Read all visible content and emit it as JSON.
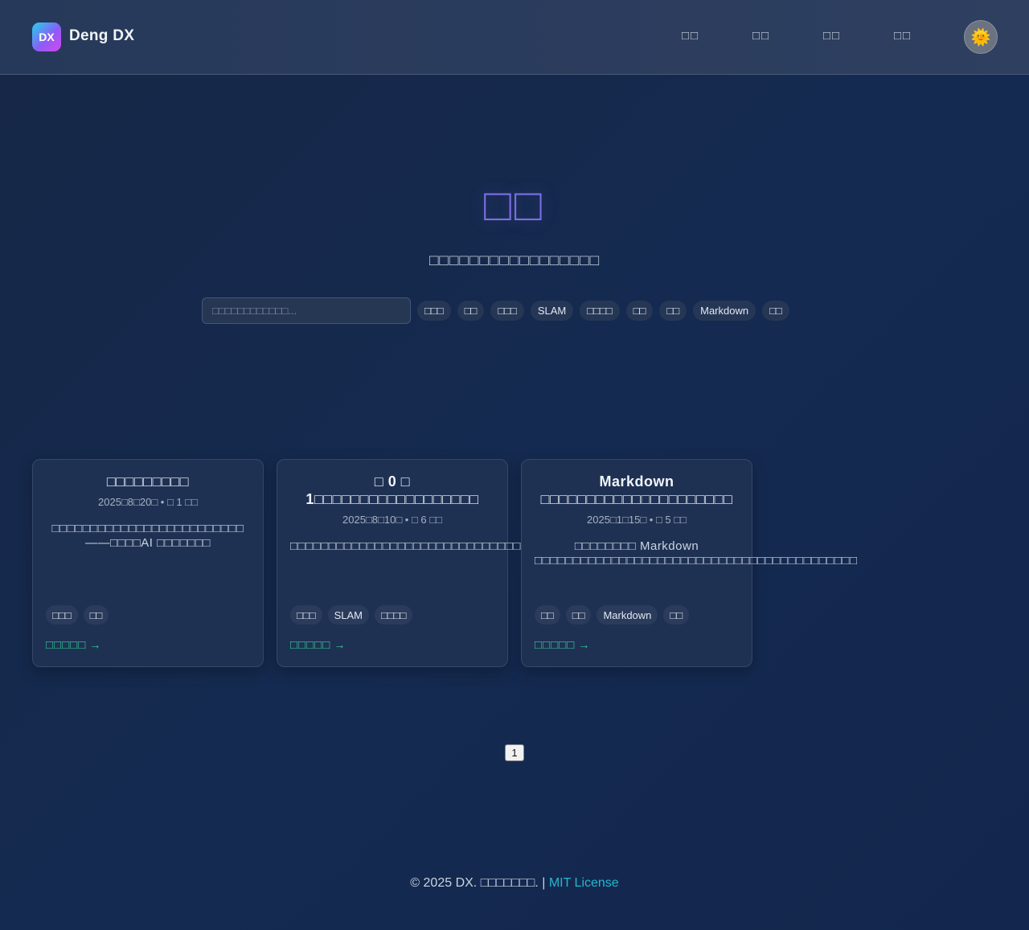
{
  "header": {
    "logo_text": "DX",
    "brand": "Deng DX",
    "nav": [
      "□□",
      "□□",
      "□□",
      "□□"
    ],
    "theme_icon": "🌞"
  },
  "hero": {
    "title": "□□",
    "subtitle": "□□□□□□□□□□□□□□□□□",
    "search_placeholder": "□□□□□□□□□□□□...",
    "filters": [
      "□□□",
      "□□",
      "□□□",
      "SLAM",
      "□□□□",
      "□□",
      "□□",
      "Markdown",
      "□□"
    ]
  },
  "posts": [
    {
      "title": "□□□□□□□□□",
      "meta": "2025□8□20□ • □ 1 □□",
      "excerpt": "□□□□□□□□□□□□□□□□□□□□□□□□□——□□□□AI □□□□□□□",
      "tags": [
        "□□□",
        "□□"
      ],
      "read_more": "□□□□□"
    },
    {
      "title": "□ 0 □ 1□□□□□□□□□□□□□□□□□□",
      "meta": "2025□8□10□ • □ 6 □□",
      "excerpt": "□□□□□□□□□□□□□□□□□□□□□□□□□□□□□□□□□□□□□□□□□□□□□□□□□□",
      "tags": [
        "□□□",
        "SLAM",
        "□□□□"
      ],
      "read_more": "□□□□□"
    },
    {
      "title": "Markdown □□□□□□□□□□□□□□□□□□□□□",
      "meta": "2025□1□15□ • □ 5 □□",
      "excerpt": "□□□□□□□□ Markdown □□□□□□□□□□□□□□□□□□□□□□□□□□□□□□□□□□□□□□□□□□",
      "tags": [
        "□□",
        "□□",
        "Markdown",
        "□□"
      ],
      "read_more": "□□□□□"
    }
  ],
  "pagination": {
    "current": "1"
  },
  "footer": {
    "copyright": "© 2025 DX. □□□□□□□. |",
    "license": "MIT License"
  }
}
